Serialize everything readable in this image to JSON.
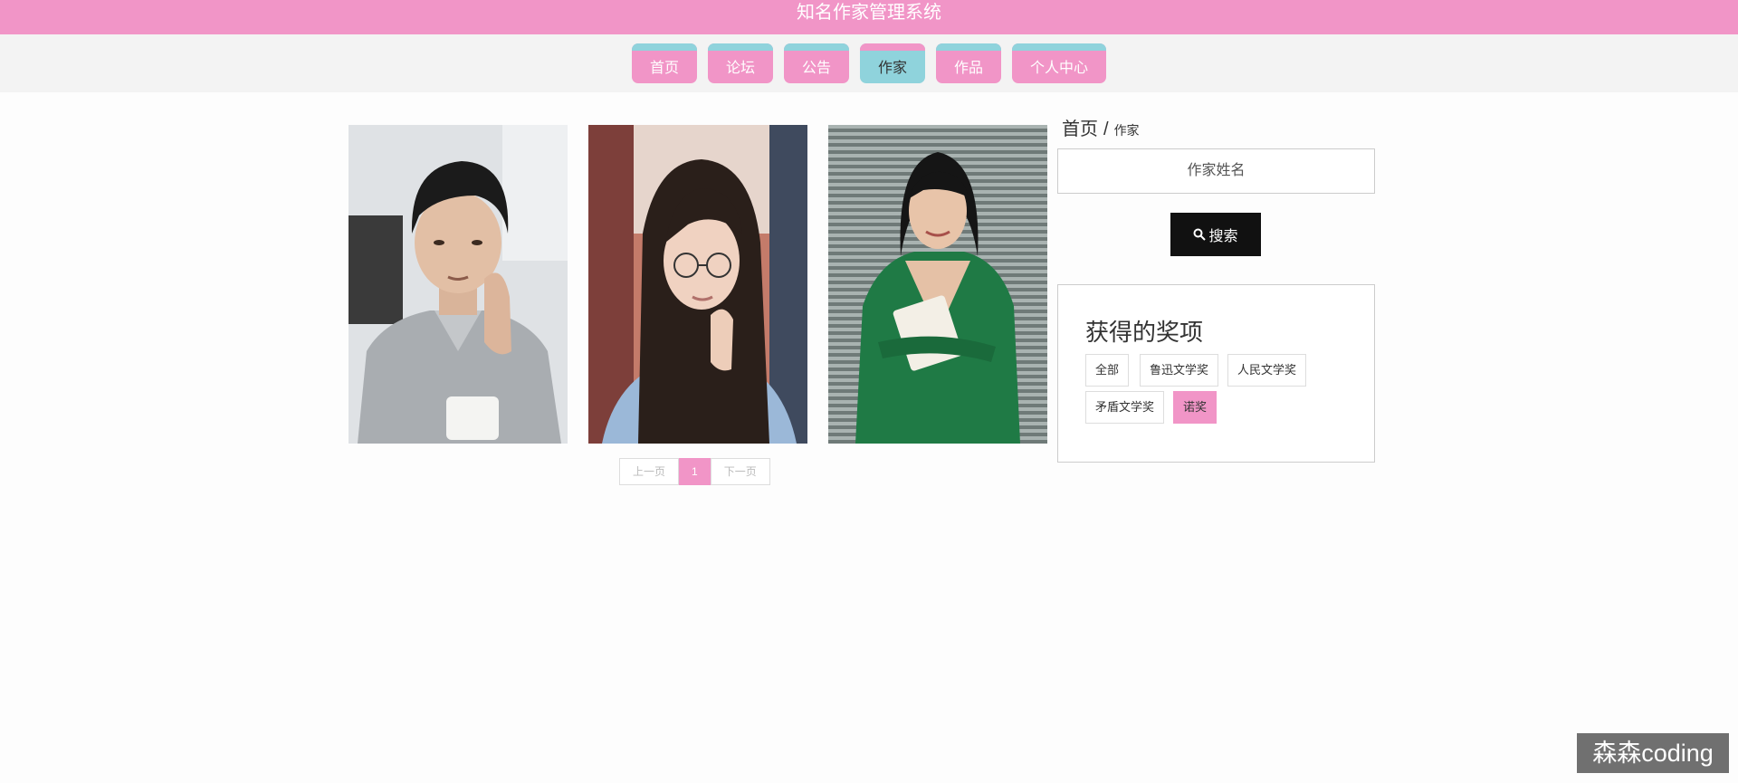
{
  "app": {
    "title": "知名作家管理系统"
  },
  "nav": {
    "items": [
      {
        "label": "首页"
      },
      {
        "label": "论坛"
      },
      {
        "label": "公告"
      },
      {
        "label": "作家",
        "active": true
      },
      {
        "label": "作品"
      },
      {
        "label": "个人中心"
      }
    ]
  },
  "writers": [
    {
      "photo": "writer-photo-man-gray-shirt"
    },
    {
      "photo": "writer-photo-woman-glasses"
    },
    {
      "photo": "writer-photo-woman-green-dress"
    }
  ],
  "pagination": {
    "prev": "上一页",
    "current": "1",
    "next": "下一页"
  },
  "breadcrumb": {
    "home": "首页",
    "separator": "/",
    "current": "作家"
  },
  "search": {
    "placeholder": "作家姓名",
    "button_label": "搜索",
    "icon": "search-icon"
  },
  "awards": {
    "title": "获得的奖项",
    "tags": [
      {
        "label": "全部"
      },
      {
        "label": "鲁迅文学奖"
      },
      {
        "label": "人民文学奖"
      },
      {
        "label": "矛盾文学奖"
      },
      {
        "label": "诺奖",
        "active": true
      }
    ]
  },
  "watermark": {
    "text": "森森coding"
  },
  "colors": {
    "primary_pink": "#f195c7",
    "accent_teal": "#8fd3dc",
    "search_button": "#111111"
  }
}
